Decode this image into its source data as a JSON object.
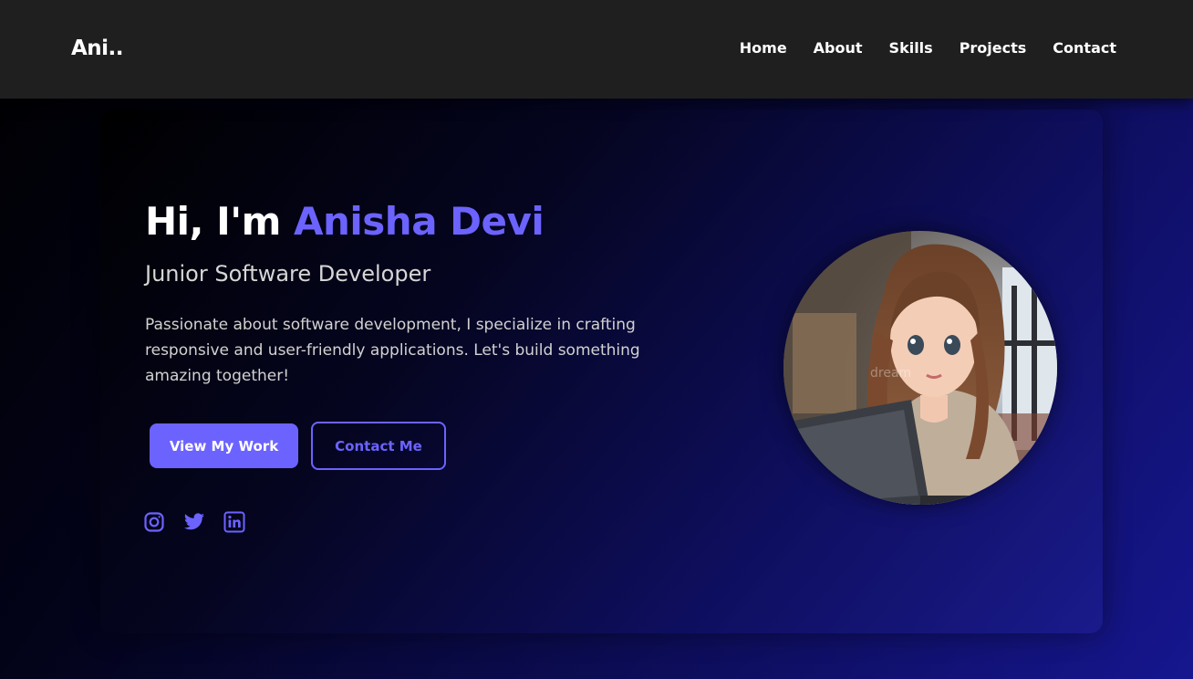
{
  "brand": {
    "logo": "Ani.."
  },
  "nav": {
    "links": [
      "Home",
      "About",
      "Skills",
      "Projects",
      "Contact"
    ]
  },
  "hero": {
    "greeting_prefix": "Hi, I'm",
    "name": "Anisha Devi",
    "role": "Junior Software Developer",
    "description": "Passionate about software development, I specialize in crafting responsive and user-friendly applications. Let's build something amazing together!",
    "primary_button": "View My Work",
    "secondary_button": "Contact Me",
    "socials": [
      "instagram-icon",
      "twitter-icon",
      "linkedin-icon"
    ],
    "avatar_watermark": "dream"
  },
  "colors": {
    "accent": "#6c63ff",
    "navbar_bg": "#1f1f1f",
    "text_primary": "#ffffff",
    "text_secondary": "#d2d2d2"
  }
}
